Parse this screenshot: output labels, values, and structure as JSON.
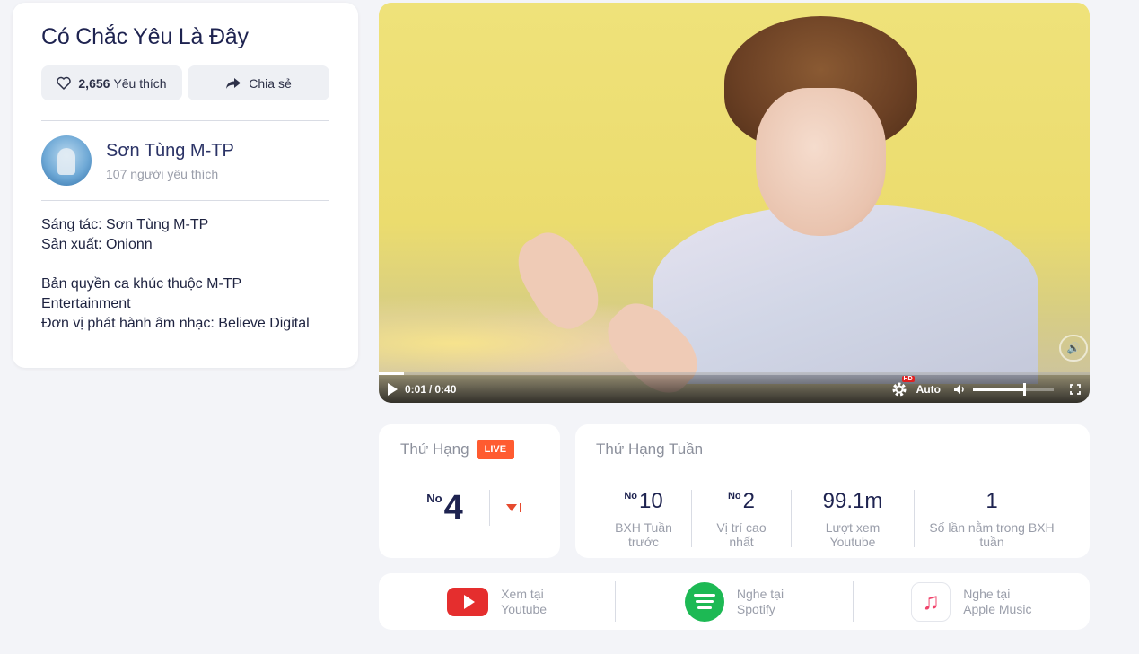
{
  "song": {
    "title": "Có Chắc Yêu Là Đây",
    "likes_count": "2,656",
    "likes_label": "Yêu thích",
    "share_label": "Chia sẻ"
  },
  "artist": {
    "name": "Sơn Tùng M-TP",
    "fans": "107 người yêu thích"
  },
  "credits": {
    "composer": "Sáng tác: Sơn Tùng M-TP",
    "producer": "Sản xuất: Onionn",
    "copyright": "Bản quyền ca khúc thuộc M-TP Entertainment",
    "distributor": "Đơn vị phát hành âm nhạc: Believe Digital"
  },
  "player": {
    "current_time": "0:01",
    "separator": "/",
    "duration": "0:40",
    "quality": "Auto",
    "hd_badge": "HD",
    "progress": 0.035,
    "volume": 0.62
  },
  "rank": {
    "label": "Thứ Hạng",
    "live_badge": "LIVE",
    "no_prefix": "No",
    "position": "4",
    "trend": "down"
  },
  "weekly": {
    "title": "Thứ Hạng Tuần",
    "stats": [
      {
        "prefix": "No",
        "value": "10",
        "caption": "BXH Tuần trước"
      },
      {
        "prefix": "No",
        "value": "2",
        "caption": "Vị trí cao nhất"
      },
      {
        "prefix": "",
        "value": "99.1m",
        "caption": "Lượt xem Youtube"
      },
      {
        "prefix": "",
        "value": "1",
        "caption": "Số lần nằm trong BXH tuần"
      }
    ]
  },
  "platforms": [
    {
      "icon": "youtube-icon",
      "line1": "Xem tại",
      "line2": "Youtube",
      "color": "#e52e2e"
    },
    {
      "icon": "spotify-icon",
      "line1": "Nghe tại",
      "line2": "Spotify",
      "color": "#1db954"
    },
    {
      "icon": "apple-music-icon",
      "line1": "Nghe tại",
      "line2": "Apple Music",
      "color": "#f0436b"
    }
  ],
  "colors": {
    "accent_live": "#ff5b30",
    "title": "#1e2350",
    "muted": "#9a9eaa",
    "trend_down": "#e64a2e"
  }
}
